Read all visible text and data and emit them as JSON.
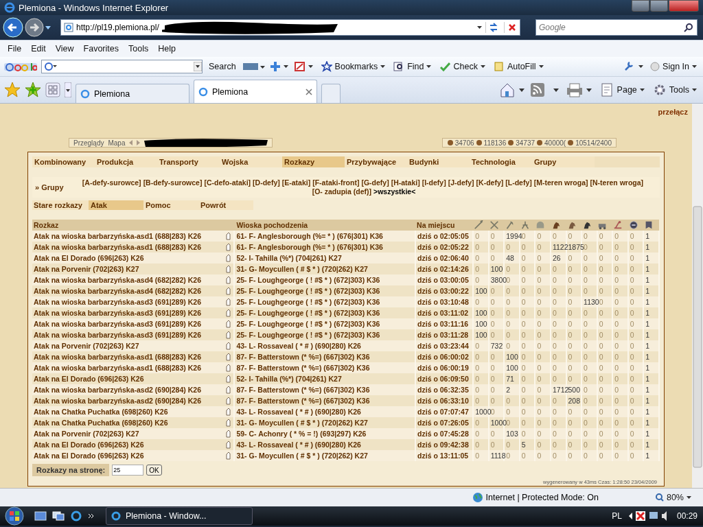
{
  "window": {
    "title": "Plemiona - Windows Internet Explorer"
  },
  "address_bar": {
    "url": "http://pl19.plemiona.pl/",
    "search_placeholder": "Google"
  },
  "menu": [
    "File",
    "Edit",
    "View",
    "Favorites",
    "Tools",
    "Help"
  ],
  "google_toolbar": {
    "search_button": "Search",
    "items": [
      {
        "label": "Bookmarks",
        "kind": "star"
      },
      {
        "label": "Find",
        "kind": "find"
      },
      {
        "label": "Check",
        "kind": "check"
      },
      {
        "label": "AutoFill",
        "kind": "autofill"
      }
    ],
    "sign_in": "Sign In"
  },
  "browser_tabs": [
    {
      "label": "Plemiona",
      "selected": false
    },
    {
      "label": "Plemiona",
      "selected": true
    }
  ],
  "command_bar": [
    "Page",
    "Tools"
  ],
  "page": {
    "switch_link": "przełącz",
    "top_strip": {
      "links": [
        "Przeglądy",
        "Mapa"
      ],
      "resources": [
        "34706",
        "118136",
        "34737",
        "40000(",
        "10514/2400"
      ]
    },
    "nav_tabs": [
      {
        "label": "Kombinowany",
        "selected": false
      },
      {
        "label": "Produkcja",
        "selected": false
      },
      {
        "label": "Transporty",
        "selected": false
      },
      {
        "label": "Wojska",
        "selected": false
      },
      {
        "label": "Rozkazy",
        "selected": true
      },
      {
        "label": "Przybywające",
        "selected": false
      },
      {
        "label": "Budynki",
        "selected": false
      },
      {
        "label": "Technologia",
        "selected": false
      },
      {
        "label": "Grupy",
        "selected": false
      }
    ],
    "groups": {
      "label": "» Grupy",
      "items": [
        "[A-defy-surowce]",
        "[B-defy-surowce]",
        "[C-defo-ataki]",
        "[D-defy]",
        "[E-ataki]",
        "[F-ataki-front]",
        "[G-defy]",
        "[H-ataki]",
        "[I-defy]",
        "[J-defy]",
        "[K-defy]",
        "[L-defy]",
        "[M-teren wroga]",
        "[N-teren wroga]",
        "[O- zadupia (def)]"
      ],
      "current": ">wszystkie<"
    },
    "sub_tabs": {
      "label": "Stare rozkazy",
      "tabs": [
        {
          "label": "Atak",
          "selected": true
        },
        {
          "label": "Pomoc",
          "selected": false
        },
        {
          "label": "Powrót",
          "selected": false
        }
      ]
    },
    "table": {
      "columns": [
        "Rozkaz",
        "Wioska pochodzenia",
        "Na miejscu"
      ],
      "rows": [
        {
          "order": "Atak na wioska barbarzyńska-asd1 (688|283) K26",
          "origin": "61- F- Anglesborough (%= * ) (676|301) K36",
          "arrival": "dziś o 02:05:05",
          "units": [
            "0",
            "0",
            "1994",
            "0",
            "0",
            "0",
            "0",
            "0",
            "0",
            "0",
            "0",
            "1"
          ]
        },
        {
          "order": "Atak na wioska barbarzyńska-asd1 (688|283) K26",
          "origin": "61- F- Anglesborough (%= * ) (676|301) K36",
          "arrival": "dziś o 02:05:22",
          "units": [
            "0",
            "0",
            "0",
            "0",
            "0",
            "1122",
            "1875",
            "0",
            "0",
            "0",
            "0",
            "1"
          ]
        },
        {
          "order": "Atak na El Dorado (696|263) K26",
          "origin": "52- I- Tahilla (%*) (704|261) K27",
          "arrival": "dziś o 02:06:40",
          "units": [
            "0",
            "0",
            "48",
            "0",
            "0",
            "26",
            "0",
            "0",
            "0",
            "0",
            "0",
            "1"
          ]
        },
        {
          "order": "Atak na Porvenir (702|263) K27",
          "origin": "31- G- Moycullen ( # $ * ) (720|262) K27",
          "arrival": "dziś o 02:14:26",
          "units": [
            "0",
            "100",
            "0",
            "0",
            "0",
            "0",
            "0",
            "0",
            "0",
            "0",
            "0",
            "1"
          ]
        },
        {
          "order": "Atak na wioska barbarzyńska-asd4 (682|282) K26",
          "origin": "25- F- Loughgeorge ( ! #$ * ) (672|303) K36",
          "arrival": "dziś o 03:00:05",
          "units": [
            "0",
            "3800",
            "0",
            "0",
            "0",
            "0",
            "0",
            "0",
            "0",
            "0",
            "0",
            "1"
          ]
        },
        {
          "order": "Atak na wioska barbarzyńska-asd4 (682|282) K26",
          "origin": "25- F- Loughgeorge ( ! #$ * ) (672|303) K36",
          "arrival": "dziś o 03:00:22",
          "units": [
            "100",
            "0",
            "0",
            "0",
            "0",
            "0",
            "0",
            "0",
            "0",
            "0",
            "0",
            "1"
          ]
        },
        {
          "order": "Atak na wioska barbarzyńska-asd3 (691|289) K26",
          "origin": "25- F- Loughgeorge ( ! #$ * ) (672|303) K36",
          "arrival": "dziś o 03:10:48",
          "units": [
            "0",
            "0",
            "0",
            "0",
            "0",
            "0",
            "0",
            "1130",
            "0",
            "0",
            "0",
            "1"
          ]
        },
        {
          "order": "Atak na wioska barbarzyńska-asd3 (691|289) K26",
          "origin": "25- F- Loughgeorge ( ! #$ * ) (672|303) K36",
          "arrival": "dziś o 03:11:02",
          "units": [
            "100",
            "0",
            "0",
            "0",
            "0",
            "0",
            "0",
            "0",
            "0",
            "0",
            "0",
            "1"
          ]
        },
        {
          "order": "Atak na wioska barbarzyńska-asd3 (691|289) K26",
          "origin": "25- F- Loughgeorge ( ! #$ * ) (672|303) K36",
          "arrival": "dziś o 03:11:16",
          "units": [
            "100",
            "0",
            "0",
            "0",
            "0",
            "0",
            "0",
            "0",
            "0",
            "0",
            "0",
            "1"
          ]
        },
        {
          "order": "Atak na wioska barbarzyńska-asd3 (691|289) K26",
          "origin": "25- F- Loughgeorge ( ! #$ * ) (672|303) K36",
          "arrival": "dziś o 03:11:28",
          "units": [
            "100",
            "0",
            "0",
            "0",
            "0",
            "0",
            "0",
            "0",
            "0",
            "0",
            "0",
            "1"
          ]
        },
        {
          "order": "Atak na Porvenir (702|263) K27",
          "origin": "43- L- Rossaveal ( * # ) (690|280) K26",
          "arrival": "dziś o 03:23:44",
          "units": [
            "0",
            "732",
            "0",
            "0",
            "0",
            "0",
            "0",
            "0",
            "0",
            "0",
            "0",
            "1"
          ]
        },
        {
          "order": "Atak na wioska barbarzyńska-asd1 (688|283) K26",
          "origin": "87- F- Batterstown (* %=) (667|302) K36",
          "arrival": "dziś o 06:00:02",
          "units": [
            "0",
            "0",
            "100",
            "0",
            "0",
            "0",
            "0",
            "0",
            "0",
            "0",
            "0",
            "1"
          ]
        },
        {
          "order": "Atak na wioska barbarzyńska-asd1 (688|283) K26",
          "origin": "87- F- Batterstown (* %=) (667|302) K36",
          "arrival": "dziś o 06:00:19",
          "units": [
            "0",
            "0",
            "100",
            "0",
            "0",
            "0",
            "0",
            "0",
            "0",
            "0",
            "0",
            "1"
          ]
        },
        {
          "order": "Atak na El Dorado (696|263) K26",
          "origin": "52- I- Tahilla (%*) (704|261) K27",
          "arrival": "dziś o 06:09:50",
          "units": [
            "0",
            "0",
            "71",
            "0",
            "0",
            "0",
            "0",
            "0",
            "0",
            "0",
            "0",
            "1"
          ]
        },
        {
          "order": "Atak na wioska barbarzyńska-asd2 (690|284) K26",
          "origin": "87- F- Batterstown (* %=) (667|302) K36",
          "arrival": "dziś o 06:32:35",
          "units": [
            "0",
            "0",
            "2",
            "0",
            "0",
            "1712",
            "500",
            "0",
            "0",
            "0",
            "0",
            "1"
          ]
        },
        {
          "order": "Atak na wioska barbarzyńska-asd2 (690|284) K26",
          "origin": "87- F- Batterstown (* %=) (667|302) K36",
          "arrival": "dziś o 06:33:10",
          "units": [
            "0",
            "0",
            "0",
            "0",
            "0",
            "0",
            "208",
            "0",
            "0",
            "0",
            "0",
            "1"
          ]
        },
        {
          "order": "Atak na Chatka Puchatka (698|260) K26",
          "origin": "43- L- Rossaveal ( * # ) (690|280) K26",
          "arrival": "dziś o 07:07:47",
          "units": [
            "1000",
            "0",
            "0",
            "0",
            "0",
            "0",
            "0",
            "0",
            "0",
            "0",
            "0",
            "1"
          ]
        },
        {
          "order": "Atak na Chatka Puchatka (698|260) K26",
          "origin": "31- G- Moycullen ( # $ * ) (720|262) K27",
          "arrival": "dziś o 07:26:05",
          "units": [
            "0",
            "1000",
            "0",
            "0",
            "0",
            "0",
            "0",
            "0",
            "0",
            "0",
            "0",
            "1"
          ]
        },
        {
          "order": "Atak na Porvenir (702|263) K27",
          "origin": "59- C- Achonry ( * % = !) (693|297) K26",
          "arrival": "dziś o 07:45:28",
          "units": [
            "0",
            "0",
            "103",
            "0",
            "0",
            "0",
            "0",
            "0",
            "0",
            "0",
            "0",
            "1"
          ]
        },
        {
          "order": "Atak na El Dorado (696|263) K26",
          "origin": "43- L- Rossaveal ( * # ) (690|280) K26",
          "arrival": "dziś o 09:42:38",
          "units": [
            "0",
            "0",
            "0",
            "5",
            "0",
            "0",
            "0",
            "0",
            "0",
            "0",
            "0",
            "1"
          ]
        },
        {
          "order": "Atak na El Dorado (696|263) K26",
          "origin": "31- G- Moycullen ( # $ * ) (720|262) K27",
          "arrival": "dziś o 13:11:05",
          "units": [
            "0",
            "1118",
            "0",
            "0",
            "0",
            "0",
            "0",
            "0",
            "0",
            "0",
            "0",
            "1"
          ]
        }
      ]
    },
    "per_page": {
      "label": "Rozkazy na stronę:",
      "value": "25",
      "button": "OK"
    },
    "footer": "wygenerowany w 43ms Czas: 1:28:50 23/04/2009"
  },
  "status_bar": {
    "zone": "Internet | Protected Mode: On",
    "zoom": "80%"
  },
  "taskbar": {
    "window": "Plemiona - Window...",
    "language": "PL",
    "time": "00:29"
  }
}
